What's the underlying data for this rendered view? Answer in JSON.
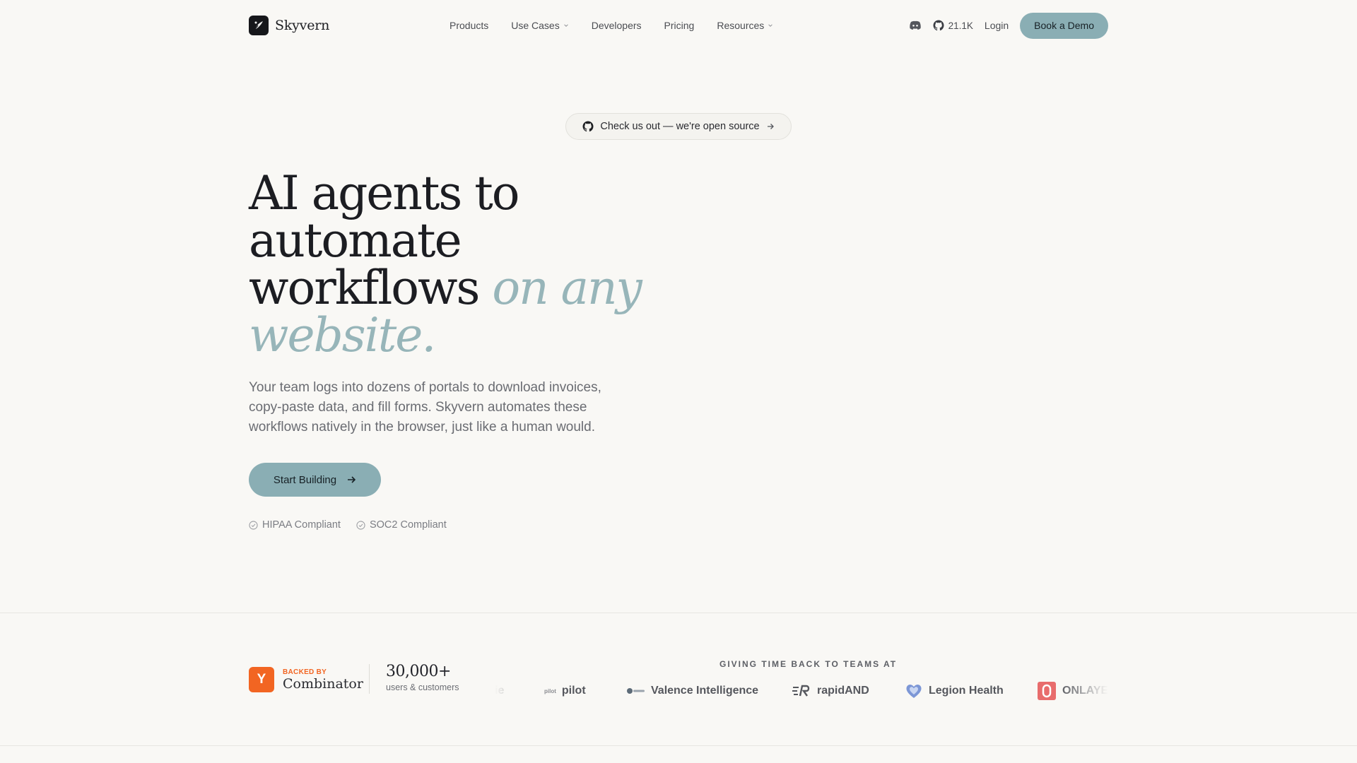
{
  "nav": {
    "brand": "Skyvern",
    "links": [
      {
        "label": "Products",
        "dropdown": false
      },
      {
        "label": "Use Cases",
        "dropdown": true
      },
      {
        "label": "Developers",
        "dropdown": false
      },
      {
        "label": "Pricing",
        "dropdown": false
      },
      {
        "label": "Resources",
        "dropdown": true
      }
    ],
    "github_stars": "21.1K",
    "login": "Login",
    "cta": "Book a Demo"
  },
  "open_source_pill": "Check us out — we're open source",
  "hero": {
    "title_line1": "AI agents to",
    "title_line2": "automate",
    "title_line3": "workflows",
    "title_accent1": "on any",
    "title_accent2": "website.",
    "subtitle": "Your team logs into dozens of portals to download invoices, copy-paste data, and fill forms. Skyvern automates these workflows natively in the browser, just like a human would.",
    "cta": "Start Building",
    "compliance": [
      "HIPAA Compliant",
      "SOC2 Compliant"
    ]
  },
  "backed": {
    "label": "BACKED BY",
    "name": "Combinator",
    "logo_letter": "Y",
    "color": "#f26522"
  },
  "stats": {
    "number": "30,000+",
    "label": "users & customers"
  },
  "logos": {
    "heading": "GIVING TIME BACK TO TEAMS AT",
    "items": [
      "ie",
      "pilot",
      "Valence Intelligence",
      "rapidAND",
      "Legion Health",
      "ONLAYE"
    ]
  },
  "colors": {
    "accent": "#8aaeb4",
    "accent_text": "#97b5b9",
    "background": "#f9f8f5",
    "yc": "#f26522"
  }
}
